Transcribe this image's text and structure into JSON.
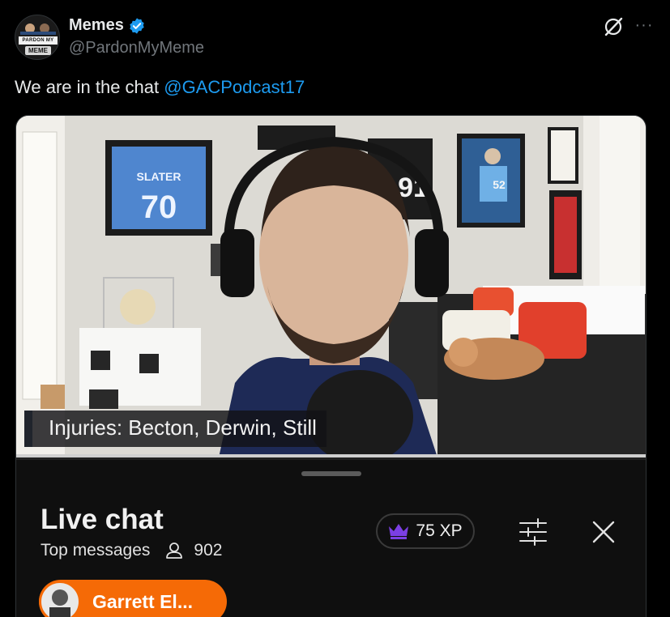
{
  "post": {
    "display_name": "Memes",
    "handle": "@PardonMyMeme",
    "avatar_band_text": "PARDON MY",
    "avatar_meme_text": "MEME",
    "text_prefix": "We are in the chat ",
    "mention": "@GACPodcast17",
    "more_label": "···"
  },
  "video": {
    "caption": "Injuries: Becton, Derwin, Still",
    "jersey_name": "SLATER",
    "jersey_number": "70",
    "poster_number": "52",
    "frame_number": "91"
  },
  "chat": {
    "title": "Live chat",
    "subtitle": "Top messages",
    "viewer_count": "902",
    "xp_label": "75 XP",
    "user_chip_name": "Garrett El..."
  },
  "colors": {
    "link": "#1d9bf0",
    "verified": "#1d9bf0",
    "chip": "#f56a06",
    "crown": "#7b3fe4"
  }
}
